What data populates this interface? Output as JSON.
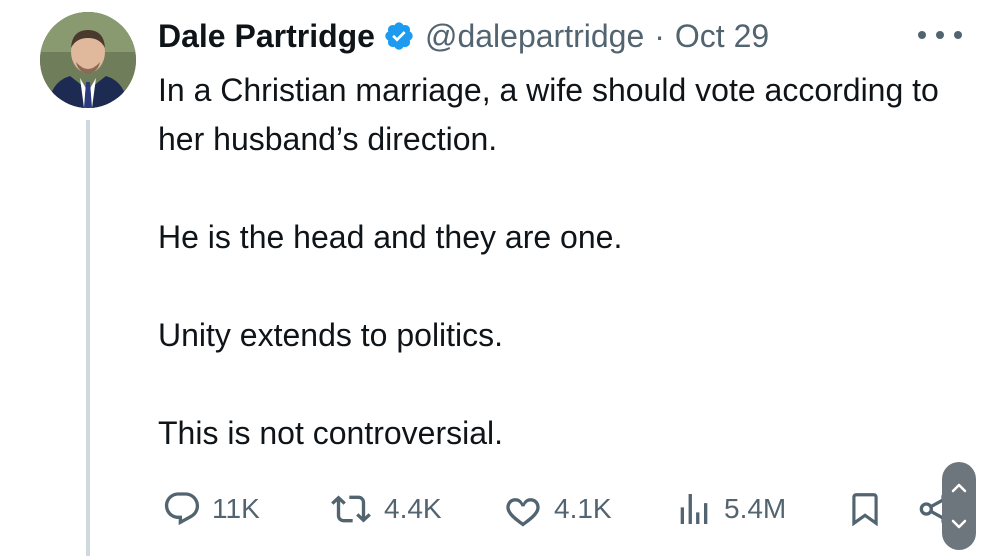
{
  "tweet": {
    "author_name": "Dale Partridge",
    "handle": "@dalepartridge",
    "separator": "·",
    "date": "Oct 29",
    "paragraphs": [
      "In a Christian marriage, a wife should vote according to her husband’s direction.",
      "He is the head and they are one.",
      "Unity extends to politics.",
      "This is not controversial."
    ],
    "verified": true
  },
  "actions": {
    "replies": "11K",
    "reposts": "4.4K",
    "likes": "4.1K",
    "views": "5.4M"
  },
  "icons": [
    "verified-badge-icon",
    "more-options-icon",
    "reply-icon",
    "repost-icon",
    "like-icon",
    "views-icon",
    "bookmark-icon",
    "share-icon",
    "scroll-up-icon",
    "scroll-down-icon"
  ],
  "colors": {
    "text": "#0f1419",
    "secondary": "#536471",
    "verified": "#1d9bf0",
    "thread_line": "#cfd9de"
  }
}
